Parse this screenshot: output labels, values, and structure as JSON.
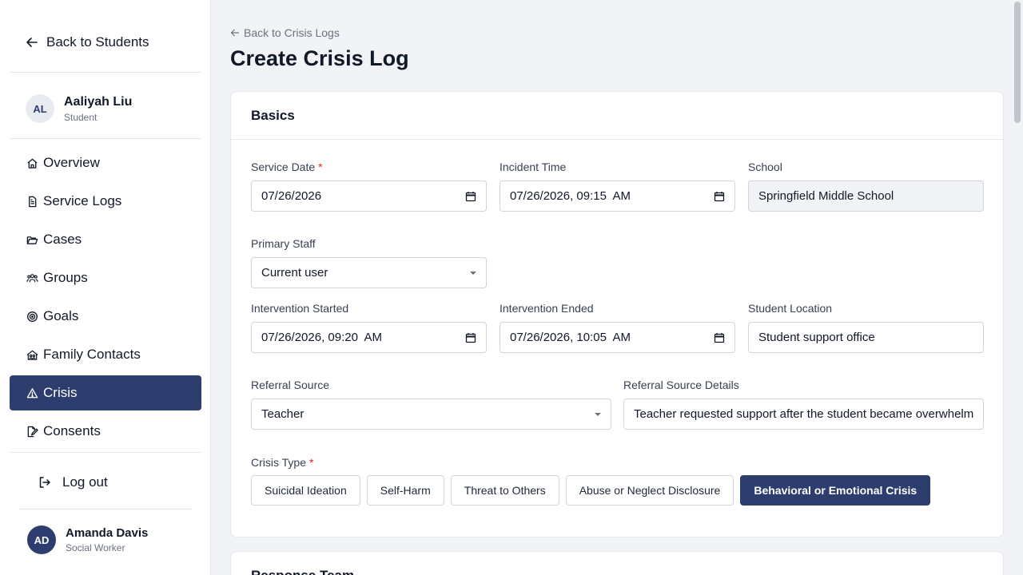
{
  "sidebar": {
    "back_label": "Back to Students",
    "student": {
      "initials": "AL",
      "name": "Aaliyah Liu",
      "role": "Student"
    },
    "nav": [
      {
        "label": "Overview",
        "icon": "home-icon"
      },
      {
        "label": "Service Logs",
        "icon": "document-icon"
      },
      {
        "label": "Cases",
        "icon": "folder-icon"
      },
      {
        "label": "Groups",
        "icon": "users-icon"
      },
      {
        "label": "Goals",
        "icon": "target-icon"
      },
      {
        "label": "Family Contacts",
        "icon": "family-icon"
      },
      {
        "label": "Crisis",
        "icon": "warning-icon",
        "active": true
      },
      {
        "label": "Consents",
        "icon": "signature-icon"
      }
    ],
    "logout_label": "Log out",
    "user": {
      "initials": "AD",
      "name": "Amanda Davis",
      "role": "Social Worker"
    }
  },
  "main": {
    "breadcrumb": "Back to Crisis Logs",
    "title": "Create Crisis Log",
    "basics": {
      "heading": "Basics",
      "service_date": {
        "label": "Service Date",
        "value": "07/26/2026"
      },
      "incident_time": {
        "label": "Incident Time",
        "value": "07/26/2026, 09:15  AM"
      },
      "school": {
        "label": "School",
        "value": "Springfield Middle School"
      },
      "primary_staff": {
        "label": "Primary Staff",
        "value": "Current user"
      },
      "intervention_started": {
        "label": "Intervention Started",
        "value": "07/26/2026, 09:20  AM"
      },
      "intervention_ended": {
        "label": "Intervention Ended",
        "value": "07/26/2026, 10:05  AM"
      },
      "student_location": {
        "label": "Student Location",
        "value": "Student support office"
      },
      "referral_source": {
        "label": "Referral Source",
        "value": "Teacher"
      },
      "referral_details": {
        "label": "Referral Source Details",
        "value": "Teacher requested support after the student became overwhelm"
      },
      "crisis_type": {
        "label": "Crisis Type",
        "options": [
          "Suicidal Ideation",
          "Self-Harm",
          "Threat to Others",
          "Abuse or Neglect Disclosure",
          "Behavioral or Emotional Crisis"
        ],
        "selected": "Behavioral or Emotional Crisis"
      },
      "required_mark": "*"
    },
    "response_team": {
      "heading": "Response Team"
    }
  },
  "colors": {
    "primary": "#2d3e6e",
    "required": "#dc2626",
    "background": "#f1f3f6"
  }
}
